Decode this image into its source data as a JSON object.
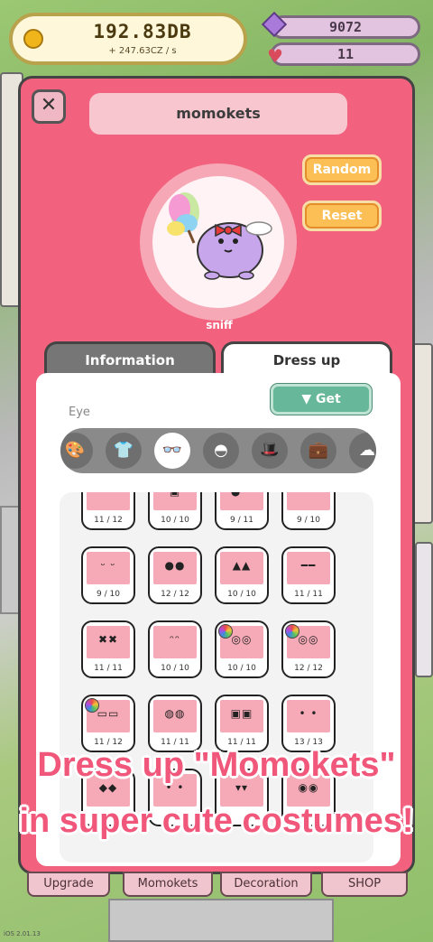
{
  "top": {
    "currency": "192.83DB",
    "rate": "+ 247.63CZ / s",
    "gems": "9072",
    "hearts": "11"
  },
  "modal": {
    "name": "momokets",
    "random_label": "Random",
    "reset_label": "Reset",
    "animation_label": "sniff",
    "tabs": [
      "Information",
      "Dress up"
    ],
    "active_tab": "Dress up"
  },
  "dressup": {
    "category_label": "Eye",
    "get_label": "▼ Get",
    "categories": [
      {
        "icon": "palette-icon"
      },
      {
        "icon": "shirt-icon"
      },
      {
        "icon": "glasses-icon",
        "selected": true
      },
      {
        "icon": "mouth-icon"
      },
      {
        "icon": "hat-icon"
      },
      {
        "icon": "bag-icon"
      },
      {
        "icon": "cloud-icon"
      }
    ],
    "items": [
      {
        "face": "• •",
        "count": "11 / 12"
      },
      {
        "face": "•▣•",
        "count": "10 / 10"
      },
      {
        "face": "● •",
        "count": "9 / 11"
      },
      {
        "face": "• •",
        "count": "9 / 10"
      },
      {
        "face": "ᵕ ᵕ",
        "count": "9 / 10"
      },
      {
        "face": "●●",
        "count": "12 / 12"
      },
      {
        "face": "▲▲",
        "count": "10 / 10"
      },
      {
        "face": "━━",
        "count": "11 / 11"
      },
      {
        "face": "✖✖",
        "count": "11 / 11"
      },
      {
        "face": "ᵔᵔ",
        "count": "10 / 10"
      },
      {
        "face": "◎◎",
        "count": "10 / 10",
        "ball": true
      },
      {
        "face": "◎◎",
        "count": "12 / 12",
        "ball": true
      },
      {
        "face": "▭▭",
        "count": "11 / 12",
        "ball": true
      },
      {
        "face": "◍◍",
        "count": "11 / 11"
      },
      {
        "face": "▣▣",
        "count": "11 / 11"
      },
      {
        "face": "• •",
        "count": "13 / 13"
      },
      {
        "face": "◆◆",
        "count": ""
      },
      {
        "face": "• •",
        "count": ""
      },
      {
        "face": "▾▾",
        "count": ""
      },
      {
        "face": "◉◉",
        "count": ""
      }
    ]
  },
  "nav": [
    "Upgrade",
    "Momokets",
    "Decoration",
    "SHOP"
  ],
  "caption": [
    "Dress up \"Momokets\"",
    "in super cute costumes!"
  ],
  "version": "iOS 2.01.13",
  "colors": {
    "modal": "#f2617d",
    "accent_orange": "#fbbf55",
    "get_green": "#67b79b",
    "caption_pink": "#f0577a"
  }
}
